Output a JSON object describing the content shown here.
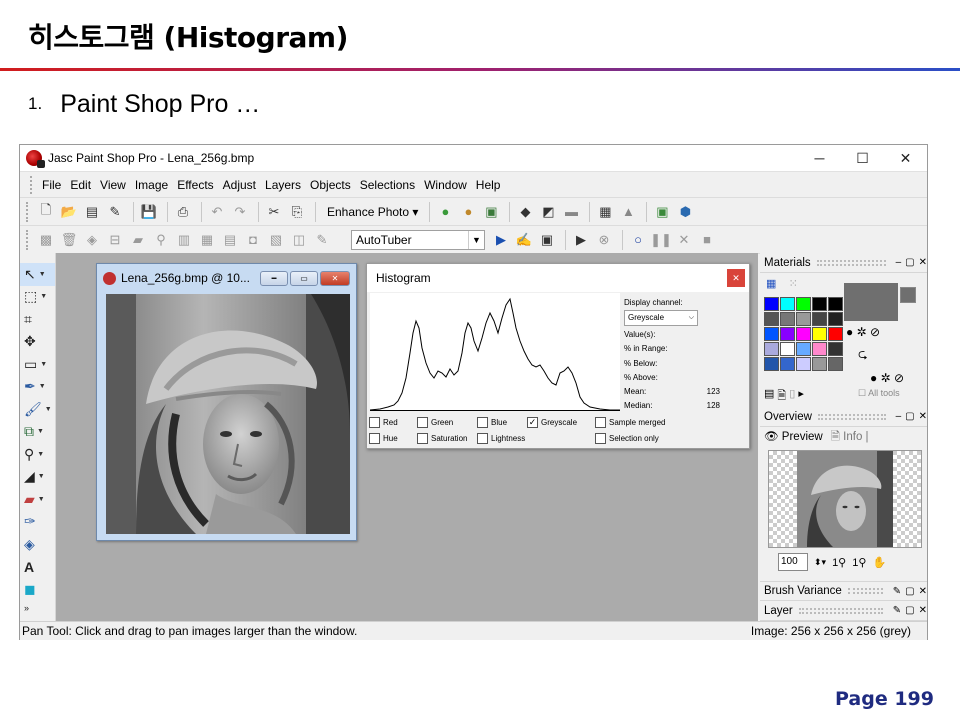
{
  "slide": {
    "title": "히스토그램 (Histogram)",
    "bullet_number": "1.",
    "bullet_text": "Paint Shop Pro …",
    "page": "Page 199"
  },
  "app": {
    "window_title": "Jasc Paint Shop Pro - Lena_256g.bmp",
    "menu": [
      "File",
      "Edit",
      "View",
      "Image",
      "Effects",
      "Adjust",
      "Layers",
      "Objects",
      "Selections",
      "Window",
      "Help"
    ],
    "enhance_photo_label": "Enhance Photo",
    "script_select": "AutoTuber",
    "image_window_title": "Lena_256g.bmp @ 10...",
    "status_left": "Pan Tool: Click and drag to pan images larger than the window.",
    "status_right": "Image:  256 x 256 x 256 (grey)"
  },
  "histogram": {
    "title": "Histogram",
    "display_channel_label": "Display channel:",
    "display_channel_value": "Greyscale",
    "values_label": "Value(s):",
    "in_range_label": "% in Range:",
    "below_label": "% Below:",
    "above_label": "% Above:",
    "mean_label": "Mean:",
    "mean_value": "123",
    "median_label": "Median:",
    "median_value": "128",
    "checkboxes": {
      "red": "Red",
      "green": "Green",
      "blue": "Blue",
      "greyscale": "Greyscale",
      "sample_merged": "Sample merged",
      "hue": "Hue",
      "saturation": "Saturation",
      "lightness": "Lightness",
      "selection_only": "Selection only"
    }
  },
  "panels": {
    "materials": "Materials",
    "all_tools": "All tools",
    "overview": "Overview",
    "preview_tab": "Preview",
    "info_tab": "Info",
    "zoom_value": "100",
    "brush_variance": "Brush Variance",
    "layer": "Layer"
  },
  "colors": {
    "title_rule_left": "#d11d1d",
    "title_rule_right": "#2a4fc7",
    "page_number": "#1f2b80",
    "workspace": "#ababab"
  }
}
